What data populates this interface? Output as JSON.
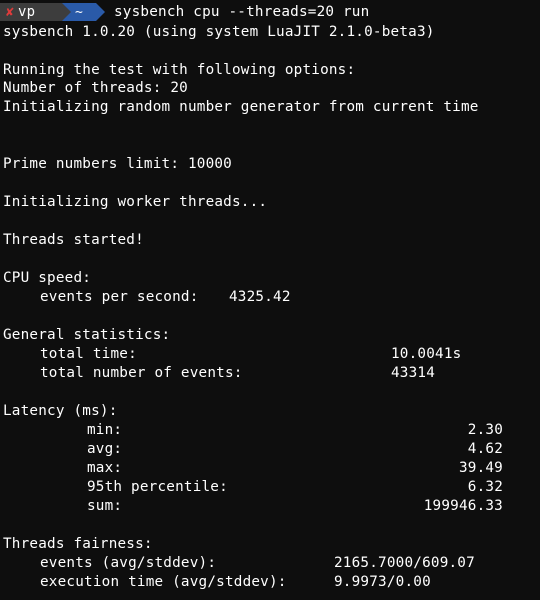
{
  "prompt": {
    "user": "vp",
    "dir": "~",
    "command": "sysbench cpu --threads=20 run"
  },
  "output": {
    "version": "sysbench 1.0.20 (using system LuaJIT 2.1.0-beta3)",
    "running": "Running the test with following options:",
    "threads": "Number of threads: 20",
    "init_rng": "Initializing random number generator from current time",
    "prime_limit": "Prime numbers limit: 10000",
    "init_workers": "Initializing worker threads...",
    "started": "Threads started!",
    "cpu_speed": {
      "heading": "CPU speed:",
      "eps_label": "events per second:",
      "eps_value": "4325.42"
    },
    "general": {
      "heading": "General statistics:",
      "total_time_label": "total time:",
      "total_time_value": "10.0041s",
      "total_events_label": "total number of events:",
      "total_events_value": "43314"
    },
    "latency": {
      "heading": "Latency (ms):",
      "min_label": "min:",
      "min_value": "2.30",
      "avg_label": "avg:",
      "avg_value": "4.62",
      "max_label": "max:",
      "max_value": "39.49",
      "p95_label": "95th percentile:",
      "p95_value": "6.32",
      "sum_label": "sum:",
      "sum_value": "199946.33"
    },
    "fairness": {
      "heading": "Threads fairness:",
      "events_label": "events (avg/stddev):",
      "events_value": "2165.7000/609.07",
      "exec_label": "execution time (avg/stddev):",
      "exec_value": "9.9973/0.00"
    }
  }
}
